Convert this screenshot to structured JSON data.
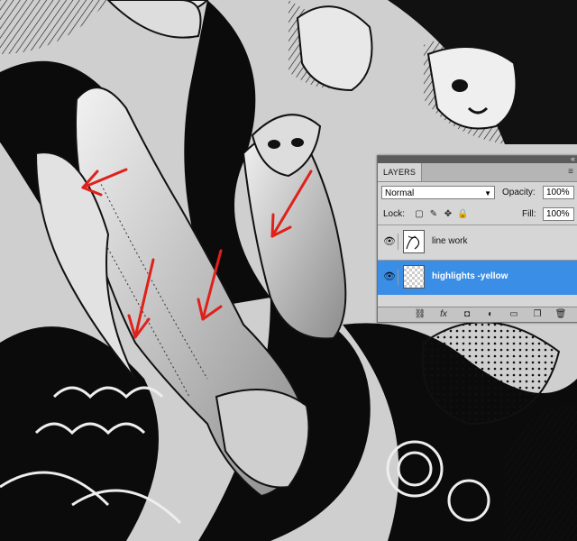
{
  "panel": {
    "tab_label": "LAYERS",
    "blend_mode": "Normal",
    "opacity_label": "Opacity:",
    "opacity_value": "100%",
    "lock_label": "Lock:",
    "fill_label": "Fill:",
    "fill_value": "100%",
    "layers": [
      {
        "name": "line work",
        "selected": false
      },
      {
        "name": "highlights -yellow",
        "selected": true
      }
    ]
  },
  "icons": {
    "collapse": "«",
    "menu": "≡",
    "eye": "👁",
    "link": "⛓",
    "fx": "fx",
    "mask": "◘",
    "adjustment": "◐",
    "group": "▭",
    "new_layer": "❐",
    "trash": "🗑"
  },
  "colors": {
    "annotation_red": "#e0201b",
    "selection_blue": "#3a8ee6"
  }
}
